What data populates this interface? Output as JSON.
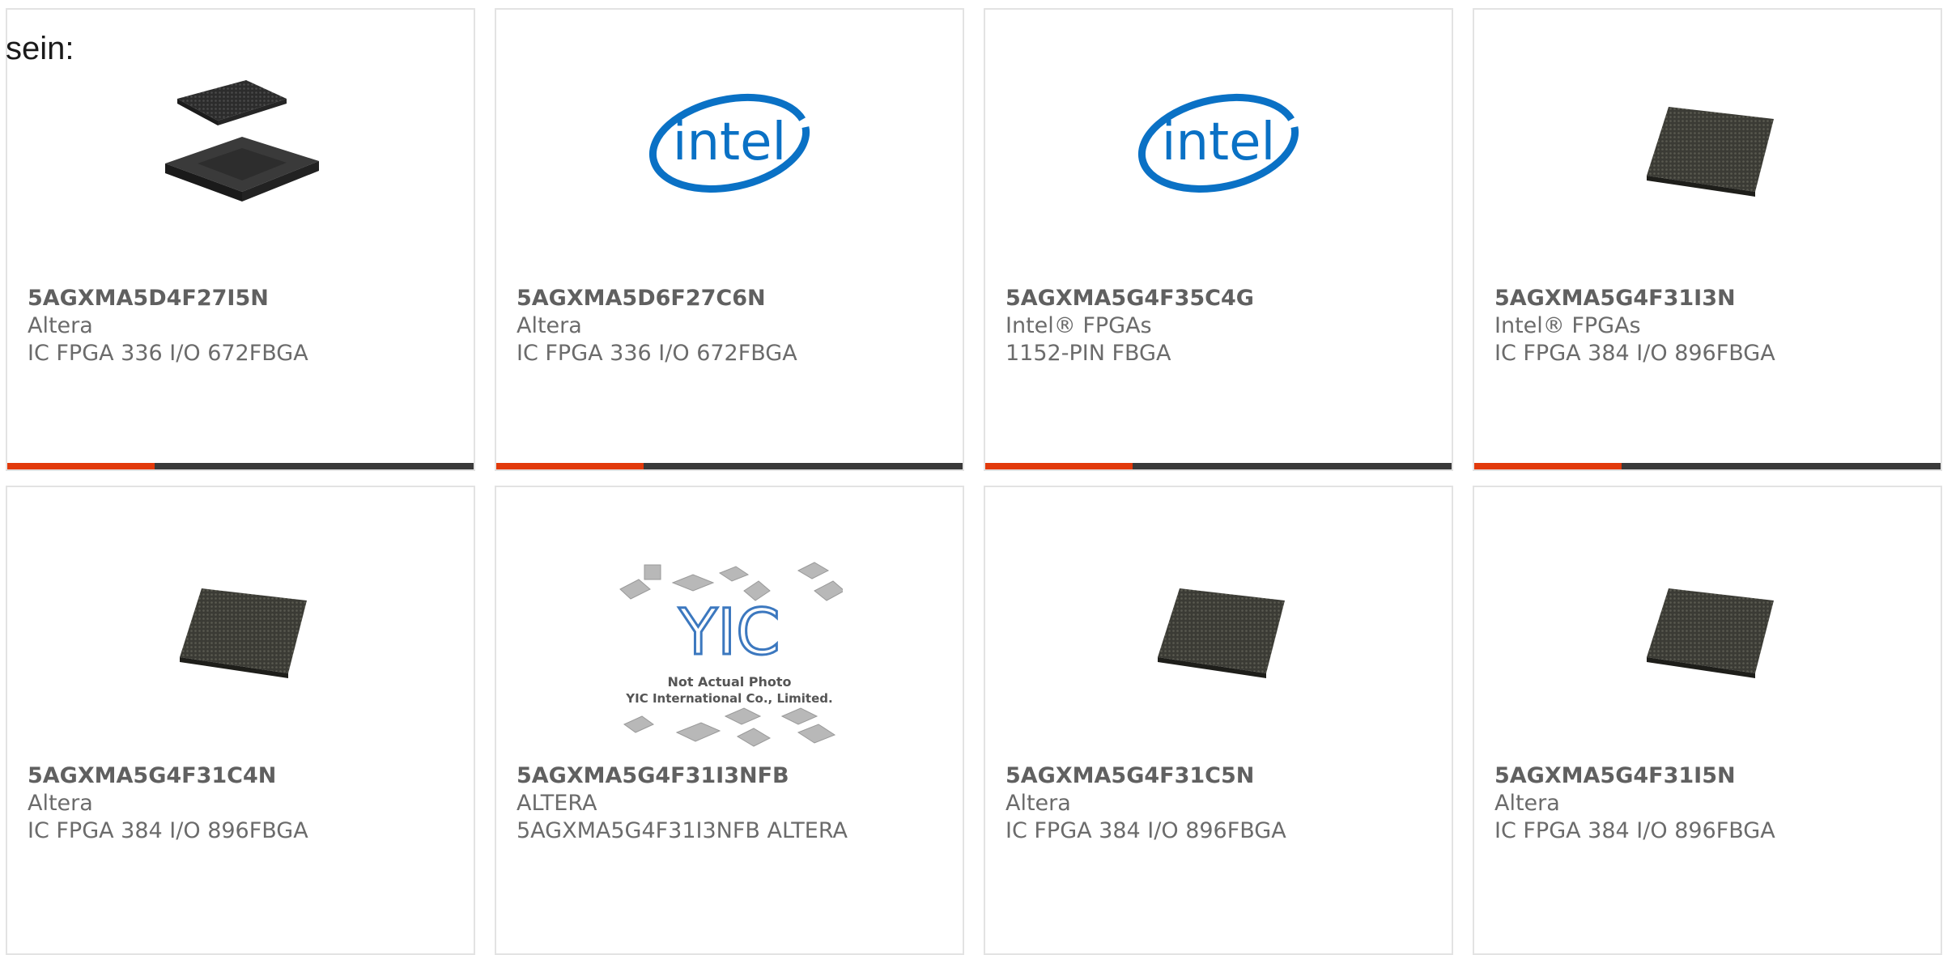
{
  "intro_text": "sein:",
  "colors": {
    "accent": "#e23a0b",
    "bar": "#3a3a3a",
    "intel_blue": "#0a71c5"
  },
  "products": [
    {
      "part_number": "5AGXMA5D4F27I5N",
      "manufacturer": "Altera",
      "description": "IC FPGA 336 I/O 672FBGA",
      "image": "bga-chip-stack-image"
    },
    {
      "part_number": "5AGXMA5D6F27C6N",
      "manufacturer": "Altera",
      "description": "IC FPGA 336 I/O 672FBGA",
      "image": "intel-logo"
    },
    {
      "part_number": "5AGXMA5G4F35C4G",
      "manufacturer": "Intel® FPGAs",
      "description": "1152-PIN FBGA",
      "image": "intel-logo"
    },
    {
      "part_number": "5AGXMA5G4F31I3N",
      "manufacturer": "Intel® FPGAs",
      "description": "IC FPGA 384 I/O 896FBGA",
      "image": "bga-chip-image"
    },
    {
      "part_number": "5AGXMA5G4F31C4N",
      "manufacturer": "Altera",
      "description": "IC FPGA 384 I/O 896FBGA",
      "image": "bga-chip-image"
    },
    {
      "part_number": "5AGXMA5G4F31I3NFB",
      "manufacturer": "ALTERA",
      "description": "5AGXMA5G4F31I3NFB ALTERA",
      "image": "placeholder-photo",
      "placeholder_logo": "YIC",
      "placeholder_line1": "Not Actual Photo",
      "placeholder_line2": "YIC International Co., Limited."
    },
    {
      "part_number": "5AGXMA5G4F31C5N",
      "manufacturer": "Altera",
      "description": "IC FPGA 384 I/O 896FBGA",
      "image": "bga-chip-image"
    },
    {
      "part_number": "5AGXMA5G4F31I5N",
      "manufacturer": "Altera",
      "description": "IC FPGA 384 I/O 896FBGA",
      "image": "bga-chip-image"
    }
  ]
}
